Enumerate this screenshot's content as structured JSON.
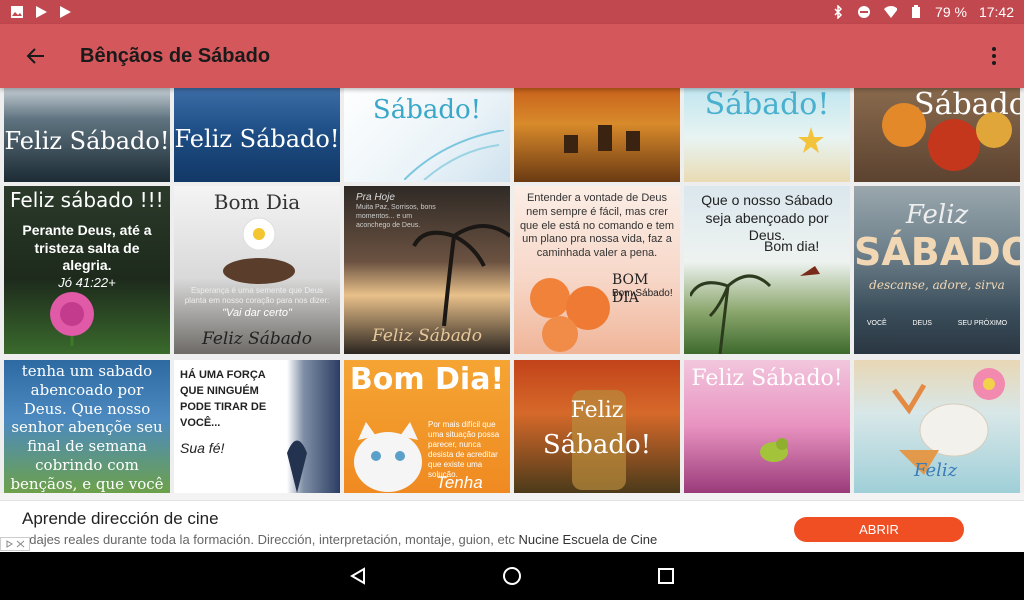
{
  "status_bar": {
    "battery_percent": "79 %",
    "time": "17:42",
    "icons": [
      "image-icon",
      "play-store-icon",
      "play-store-icon",
      "bluetooth-icon",
      "do-not-disturb-icon",
      "wifi-icon",
      "battery-icon"
    ]
  },
  "app_bar": {
    "title": "Bênçãos de Sábado",
    "back_icon": "arrow-back-icon",
    "menu_icon": "more-vert-icon"
  },
  "tiles": {
    "row1": [
      {
        "caption": "Feliz Sábado!"
      },
      {
        "caption": "Feliz Sábado!"
      },
      {
        "caption": "Sábado!"
      },
      {
        "caption": ""
      },
      {
        "caption": "Sábado!"
      },
      {
        "caption": "Sábado"
      }
    ],
    "row2": [
      {
        "title": "Feliz sábado !!!",
        "body": "Perante Deus, até a tristeza salta de alegria.",
        "ref": "Jó 41:22+"
      },
      {
        "title": "Bom Dia",
        "body": "Esperança é uma semente que Deus planta em nosso coração para nos dizer:",
        "quote": "\"Vai dar certo\"",
        "footer": "Feliz Sábado"
      },
      {
        "title": "Pra Hoje",
        "body": "Muita Paz, Sorrisos, bons momentos... e um aconchego de Deus.",
        "footer": "Feliz Sábado"
      },
      {
        "body": "Entender a vontade de Deus nem sempre é fácil, mas crer que ele está no comando e tem um plano pra nossa vida, faz a caminhada valer a pena.",
        "footer": "BOM DIA",
        "footer2": "Bom Sábado!"
      },
      {
        "body": "Que o nosso Sábado seja abençoado por Deus.",
        "footer": "Bom dia!"
      },
      {
        "title": "Feliz",
        "big": "SÁBADO",
        "sub": "descanse, adore, sirva",
        "labels": [
          "VOCÊ",
          "DEUS",
          "SEU PRÓXIMO"
        ]
      }
    ],
    "row3": [
      {
        "body": "tenha um sabado abencoado por Deus. Que nosso senhor abençõe seu final de semana cobrindo com bençãos, e que você possa ter"
      },
      {
        "body": "HÁ UMA FORÇA QUE NINGUÉM PODE TIRAR DE VOCÊ...",
        "footer": "Sua fé!"
      },
      {
        "title": "Bom Dia!",
        "body": "Por mais difícil que uma situação possa parecer, nunca desista de acreditar que existe uma solução.",
        "footer": "Tenha Fé"
      },
      {
        "title": "Feliz",
        "footer": "Sábado!"
      },
      {
        "title": "Feliz Sábado!"
      },
      {
        "footer": "Feliz"
      }
    ]
  },
  "ad": {
    "title": "Aprende dirección de cine",
    "description": "odajes reales durante toda la formación. Dirección, interpretación, montaje, guion, etc",
    "advertiser": "Nucine Escuela de Cine",
    "cta": "ABRIR"
  },
  "nav_bar": {
    "icons": [
      "back-triangle-icon",
      "home-circle-icon",
      "recents-square-icon"
    ]
  }
}
